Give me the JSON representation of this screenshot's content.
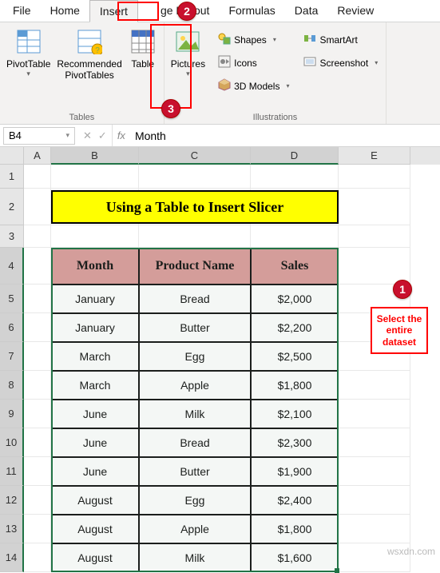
{
  "ribbon": {
    "tabs": [
      "File",
      "Home",
      "Insert",
      "Page Layout",
      "Formulas",
      "Data",
      "Review"
    ],
    "active_tab": "Insert",
    "groups": {
      "tables": {
        "label": "Tables",
        "pivottable": "PivotTable",
        "recommended": "Recommended\nPivotTables",
        "table": "Table"
      },
      "illustrations": {
        "label": "Illustrations",
        "pictures": "Pictures",
        "shapes": "Shapes",
        "icons": "Icons",
        "models": "3D Models",
        "smartart": "SmartArt",
        "screenshot": "Screenshot"
      }
    }
  },
  "formula_bar": {
    "name_box": "B4",
    "cancel": "✕",
    "accept": "✓",
    "fx": "fx",
    "value": "Month"
  },
  "steps": {
    "s1": "1",
    "s2": "2",
    "s3": "3",
    "callout": "Select the entire dataset"
  },
  "grid": {
    "cols": [
      "A",
      "B",
      "C",
      "D",
      "E"
    ],
    "rows": [
      "1",
      "2",
      "3",
      "4",
      "5",
      "6",
      "7",
      "8",
      "9",
      "10",
      "11",
      "12",
      "13",
      "14"
    ],
    "title": "Using a Table to Insert Slicer"
  },
  "chart_data": {
    "type": "table",
    "headers": [
      "Month",
      "Product Name",
      "Sales"
    ],
    "rows": [
      [
        "January",
        "Bread",
        "$2,000"
      ],
      [
        "January",
        "Butter",
        "$2,200"
      ],
      [
        "March",
        "Egg",
        "$2,500"
      ],
      [
        "March",
        "Apple",
        "$1,800"
      ],
      [
        "June",
        "Milk",
        "$2,100"
      ],
      [
        "June",
        "Bread",
        "$2,300"
      ],
      [
        "June",
        "Butter",
        "$1,900"
      ],
      [
        "August",
        "Egg",
        "$2,400"
      ],
      [
        "August",
        "Apple",
        "$1,800"
      ],
      [
        "August",
        "Milk",
        "$1,600"
      ]
    ]
  },
  "watermark": "wsxdn.com"
}
